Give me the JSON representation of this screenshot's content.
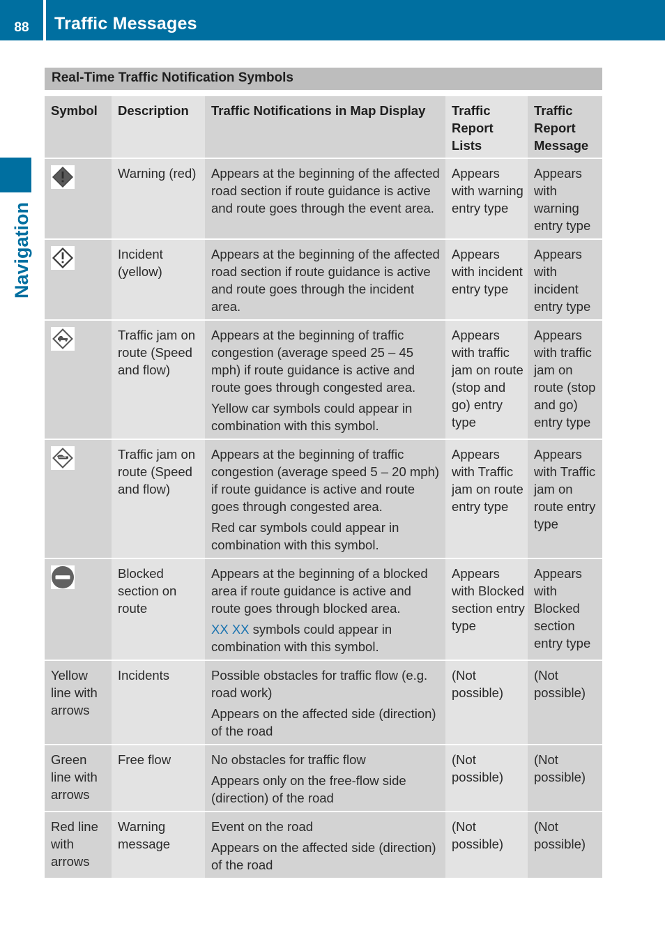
{
  "header": {
    "page_number": "88",
    "title": "Traffic Messages"
  },
  "side_tab": {
    "label": "Navigation"
  },
  "colors": {
    "brand_blue": "#006fa0",
    "link_blue": "#1a73b0",
    "title_bar": "#bdbdbd",
    "cell_dark": "#d3d3d3",
    "cell_light": "#e3e3e3"
  },
  "section": {
    "title": "Real-Time Traffic Notification Symbols"
  },
  "table": {
    "headers": [
      "Symbol",
      "Description",
      "Traffic Notifications in Map Display",
      "Traffic Report Lists",
      "Traffic Report Message"
    ],
    "rows": [
      {
        "symbol_icon": "warning-red-icon",
        "symbol_text": "",
        "description": "Warning (red)",
        "map_display": [
          "Appears at the beginning of the affected road section if route guidance is active and route goes through the event area."
        ],
        "report_lists": "Appears with warning entry type",
        "report_message": "Appears with warning entry type"
      },
      {
        "symbol_icon": "incident-yellow-icon",
        "symbol_text": "",
        "description": "Incident (yellow)",
        "map_display": [
          "Appears at the beginning of the affected road section if route guidance is active and route goes through the incident area."
        ],
        "report_lists": "Appears with incident entry type",
        "report_message": "Appears with incident entry type"
      },
      {
        "symbol_icon": "traffic-jam-yellow-icon",
        "symbol_text": "",
        "description": "Traffic jam on route (Speed and flow)",
        "map_display": [
          "Appears at the beginning of traffic congestion (average speed 25 – 45 mph) if route guidance is active and route goes through congested area.",
          "Yellow car symbols could appear in combination with this symbol."
        ],
        "report_lists": "Appears with traffic jam on route (stop and go) entry type",
        "report_message": "Appears with traffic jam on route (stop and go) entry type"
      },
      {
        "symbol_icon": "traffic-jam-red-icon",
        "symbol_text": "",
        "description": "Traffic jam on route (Speed and flow)",
        "map_display": [
          "Appears at the beginning of traffic congestion (average speed 5 – 20 mph) if route guidance is active and route goes through congested area.",
          "Red car symbols could appear in combination with this symbol."
        ],
        "report_lists": "Appears with Traffic jam on route entry type",
        "report_message": "Appears with Traffic jam on route entry type"
      },
      {
        "symbol_icon": "blocked-road-icon",
        "symbol_text": "",
        "description": "Blocked section on route",
        "map_display_first": "Appears at the beginning of a blocked area if route guidance is active and route goes through blocked area.",
        "map_display_highlight": "XX XX",
        "map_display_rest": " symbols could appear in combination with this symbol.",
        "report_lists": "Appears with Blocked section entry type",
        "report_message": "Appears with Blocked section entry type"
      },
      {
        "symbol_icon": "",
        "symbol_text": "Yellow line with arrows",
        "description": "Incidents",
        "map_display": [
          "Possible obstacles for traffic flow (e.g. road work)",
          "Appears on the affected side (direction) of the road"
        ],
        "report_lists": "(Not possible)",
        "report_message": "(Not possible)"
      },
      {
        "symbol_icon": "",
        "symbol_text": "Green line with arrows",
        "description": "Free flow",
        "map_display": [
          "No obstacles for traffic flow",
          "Appears only on the free-flow side (direction) of the road"
        ],
        "report_lists": "(Not possible)",
        "report_message": "(Not possible)"
      },
      {
        "symbol_icon": "",
        "symbol_text": "Red line with arrows",
        "description": "Warning message",
        "map_display": [
          "Event on the road",
          "Appears on the affected side (direction) of the road"
        ],
        "report_lists": "(Not possible)",
        "report_message": "(Not possible)"
      }
    ]
  }
}
